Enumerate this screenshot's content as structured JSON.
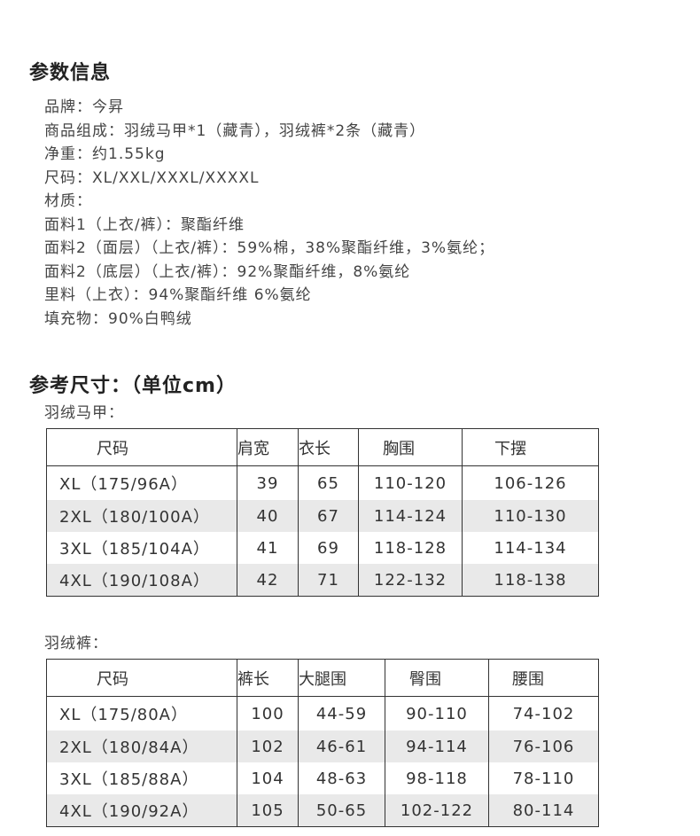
{
  "params": {
    "title": "参数信息",
    "lines": [
      "品牌：今昇",
      "商品组成：羽绒马甲*1（藏青），羽绒裤*2条（藏青）",
      "净重：约1.55kg",
      "尺码：XL/XXL/XXXL/XXXXL",
      "材质：",
      "面料1（上衣/裤）：聚酯纤维",
      "面料2（面层）（上衣/裤）：59%棉，38%聚酯纤维，3%氨纶；",
      "面料2（底层）（上衣/裤）：92%聚酯纤维，8%氨纶",
      "里料（上衣）：94%聚酯纤维  6%氨纶",
      "填充物：90%白鸭绒"
    ]
  },
  "size_ref": {
    "title": "参考尺寸：（单位cm）",
    "vest": {
      "label": "羽绒马甲：",
      "headers": [
        "尺码",
        "肩宽",
        "衣长",
        "胸围",
        "下摆"
      ],
      "rows": [
        [
          "XL（175/96A）",
          "39",
          "65",
          "110-120",
          "106-126"
        ],
        [
          "2XL（180/100A）",
          "40",
          "67",
          "114-124",
          "110-130"
        ],
        [
          "3XL（185/104A）",
          "41",
          "69",
          "118-128",
          "114-134"
        ],
        [
          "4XL（190/108A）",
          "42",
          "71",
          "122-132",
          "118-138"
        ]
      ]
    },
    "pants": {
      "label": "羽绒裤：",
      "headers": [
        "尺码",
        "裤长",
        "大腿围",
        "臀围",
        "腰围"
      ],
      "rows": [
        [
          "XL（175/80A）",
          "100",
          "44-59",
          "90-110",
          "74-102"
        ],
        [
          "2XL（180/84A）",
          "102",
          "46-61",
          "94-114",
          "76-106"
        ],
        [
          "3XL（185/88A）",
          "104",
          "48-63",
          "98-118",
          "78-110"
        ],
        [
          "4XL（190/92A）",
          "105",
          "50-65",
          "102-122",
          "80-114"
        ]
      ]
    }
  }
}
